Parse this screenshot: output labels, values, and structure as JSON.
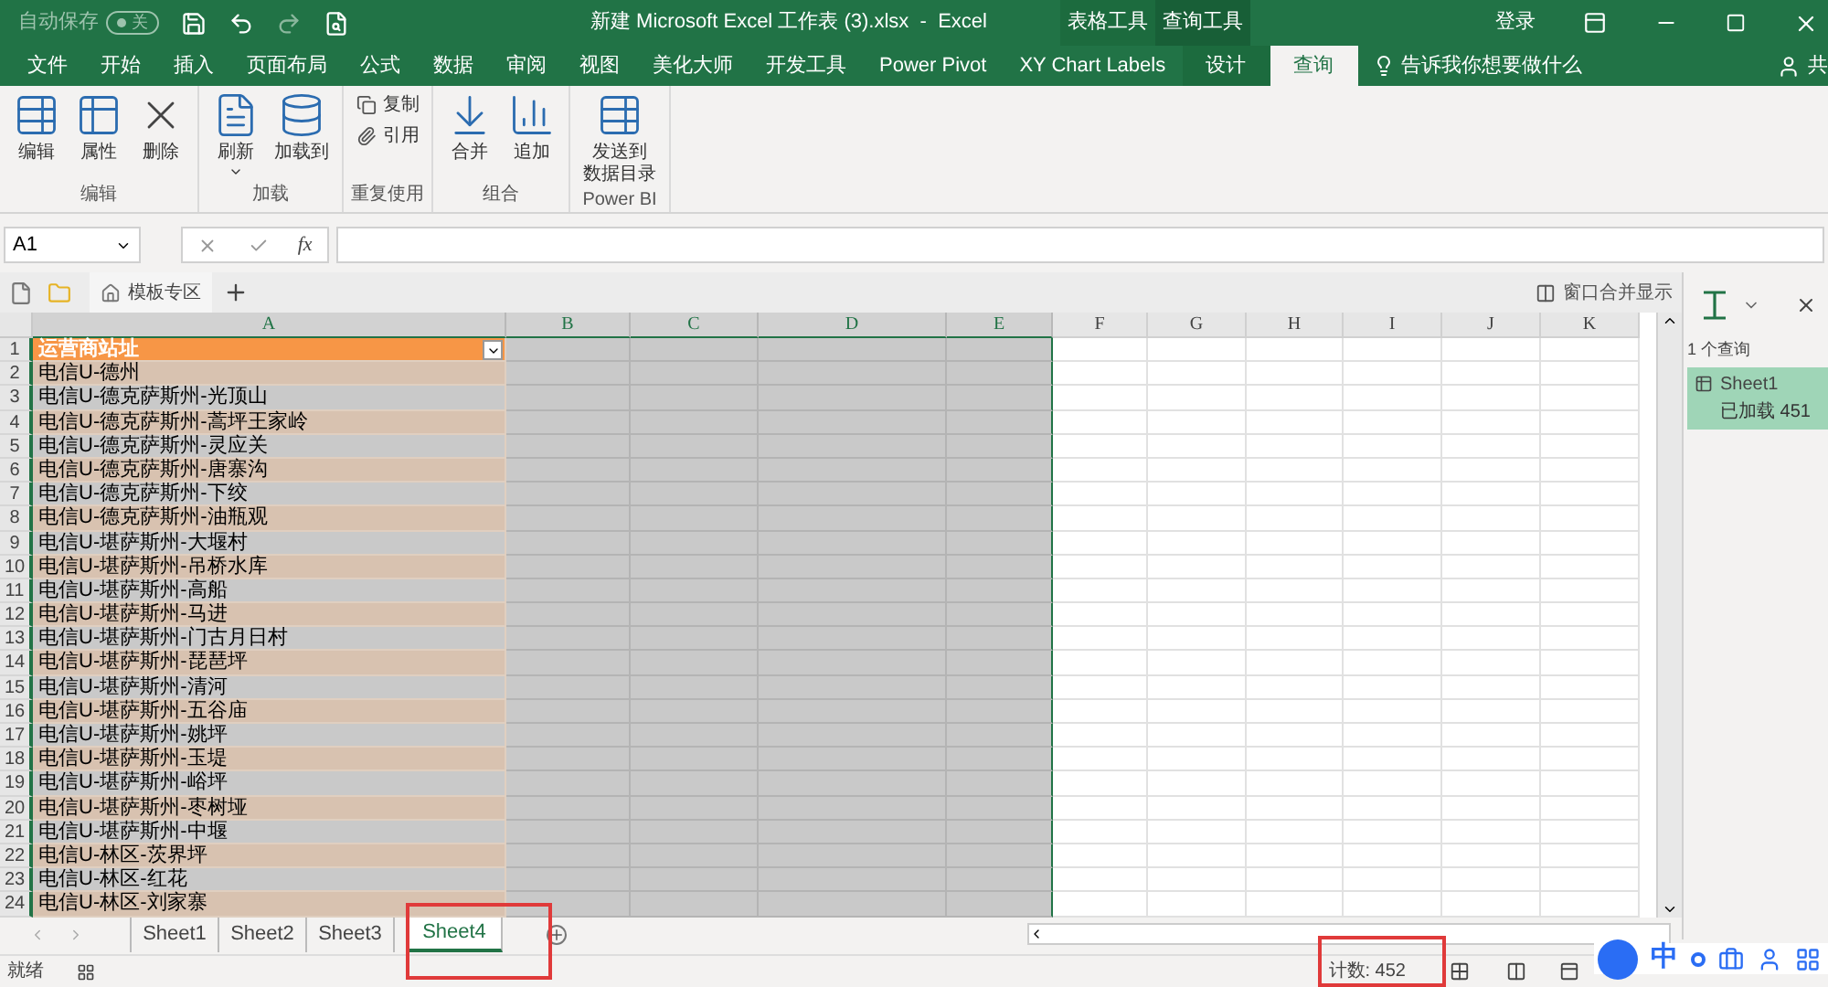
{
  "title_bar": {
    "autosave_label": "自动保存",
    "autosave_toggle": "关",
    "title": "新建 Microsoft Excel 工作表 (3).xlsx  -  Excel",
    "contextual_groups": [
      "表格工具",
      "查询工具"
    ],
    "sign_in": "登录"
  },
  "ribbon_tabs": [
    {
      "label": "文件",
      "kind": "normal",
      "selected": false
    },
    {
      "label": "开始",
      "kind": "normal",
      "selected": false
    },
    {
      "label": "插入",
      "kind": "normal",
      "selected": false
    },
    {
      "label": "页面布局",
      "kind": "normal",
      "selected": false
    },
    {
      "label": "公式",
      "kind": "normal",
      "selected": false
    },
    {
      "label": "数据",
      "kind": "normal",
      "selected": false
    },
    {
      "label": "审阅",
      "kind": "normal",
      "selected": false
    },
    {
      "label": "视图",
      "kind": "normal",
      "selected": false
    },
    {
      "label": "美化大师",
      "kind": "normal",
      "selected": false
    },
    {
      "label": "开发工具",
      "kind": "normal",
      "selected": false
    },
    {
      "label": "Power Pivot",
      "kind": "normal",
      "selected": false
    },
    {
      "label": "XY Chart Labels",
      "kind": "normal",
      "selected": false
    },
    {
      "label": "设计",
      "kind": "contextual",
      "selected": false
    },
    {
      "label": "查询",
      "kind": "contextual",
      "selected": true
    }
  ],
  "tell_me": "告诉我你想要做什么",
  "share": "共",
  "ribbon_groups": [
    {
      "label": "编辑",
      "buttons": [
        {
          "label": "编辑",
          "kind": "large"
        },
        {
          "label": "属性",
          "kind": "large"
        },
        {
          "label": "删除",
          "kind": "large"
        }
      ]
    },
    {
      "label": "加载",
      "buttons": [
        {
          "label": "刷新",
          "kind": "dropdown"
        },
        {
          "label": "加载到",
          "kind": "large"
        }
      ]
    },
    {
      "label": "重复使用",
      "buttons": [
        {
          "label": "复制",
          "kind": "small"
        },
        {
          "label": "引用",
          "kind": "small"
        }
      ]
    },
    {
      "label": "组合",
      "buttons": [
        {
          "label": "合并",
          "kind": "large"
        },
        {
          "label": "追加",
          "kind": "large"
        }
      ]
    },
    {
      "label": "Power BI",
      "buttons": [
        {
          "label_lines": [
            "发送到",
            "数据目录"
          ],
          "kind": "large"
        }
      ]
    }
  ],
  "name_box": "A1",
  "function_button": "fx",
  "doc_tabs": [
    "模板专区"
  ],
  "merge_display": "窗口合并显示",
  "columns": [
    {
      "label": "A",
      "selected": true
    },
    {
      "label": "B",
      "selected": true
    },
    {
      "label": "C",
      "selected": true
    },
    {
      "label": "D",
      "selected": true
    },
    {
      "label": "E",
      "selected": true
    },
    {
      "label": "F",
      "selected": false
    },
    {
      "label": "G",
      "selected": false
    },
    {
      "label": "H",
      "selected": false
    },
    {
      "label": "I",
      "selected": false
    },
    {
      "label": "J",
      "selected": false
    },
    {
      "label": "K",
      "selected": false
    }
  ],
  "rows": [
    {
      "number": "1",
      "value": "运营商站址",
      "kind": "header"
    },
    {
      "number": "2",
      "value": "电信U-德州",
      "kind": "data"
    },
    {
      "number": "3",
      "value": "电信U-德克萨斯州-光顶山",
      "kind": "data"
    },
    {
      "number": "4",
      "value": "电信U-德克萨斯州-蒿坪王家岭",
      "kind": "data"
    },
    {
      "number": "5",
      "value": "电信U-德克萨斯州-灵应关",
      "kind": "data"
    },
    {
      "number": "6",
      "value": "电信U-德克萨斯州-唐寨沟",
      "kind": "data"
    },
    {
      "number": "7",
      "value": "电信U-德克萨斯州-下绞",
      "kind": "data"
    },
    {
      "number": "8",
      "value": "电信U-德克萨斯州-油瓶观",
      "kind": "data"
    },
    {
      "number": "9",
      "value": "电信U-堪萨斯州-大堰村",
      "kind": "data"
    },
    {
      "number": "10",
      "value": "电信U-堪萨斯州-吊桥水库",
      "kind": "data"
    },
    {
      "number": "11",
      "value": "电信U-堪萨斯州-高船",
      "kind": "data"
    },
    {
      "number": "12",
      "value": "电信U-堪萨斯州-马进",
      "kind": "data"
    },
    {
      "number": "13",
      "value": "电信U-堪萨斯州-门古月日村",
      "kind": "data"
    },
    {
      "number": "14",
      "value": "电信U-堪萨斯州-琵琶坪",
      "kind": "data"
    },
    {
      "number": "15",
      "value": "电信U-堪萨斯州-清河",
      "kind": "data"
    },
    {
      "number": "16",
      "value": "电信U-堪萨斯州-五谷庙",
      "kind": "data"
    },
    {
      "number": "17",
      "value": "电信U-堪萨斯州-姚坪",
      "kind": "data"
    },
    {
      "number": "18",
      "value": "电信U-堪萨斯州-玉堤",
      "kind": "data"
    },
    {
      "number": "19",
      "value": "电信U-堪萨斯州-峪坪",
      "kind": "data"
    },
    {
      "number": "20",
      "value": "电信U-堪萨斯州-枣树垭",
      "kind": "data"
    },
    {
      "number": "21",
      "value": "电信U-堪萨斯州-中堰",
      "kind": "data"
    },
    {
      "number": "22",
      "value": "电信U-林区-茨界坪",
      "kind": "data"
    },
    {
      "number": "23",
      "value": "电信U-林区-红花",
      "kind": "data"
    },
    {
      "number": "24",
      "value": "电信U-林区-刘家寨",
      "kind": "data"
    }
  ],
  "sheet_tabs": [
    {
      "label": "Sheet1",
      "selected": false
    },
    {
      "label": "Sheet2",
      "selected": false
    },
    {
      "label": "Sheet3",
      "selected": false
    },
    {
      "label": "Sheet4",
      "selected": true
    }
  ],
  "query_pane": {
    "count": "1 个查询",
    "queries": [
      {
        "name": "Sheet1",
        "status": "已加载 451",
        "selected": true
      }
    ]
  },
  "status_bar": {
    "ready": "就绪",
    "count": "计数: 452"
  },
  "ime_bar": {
    "mode": "中"
  }
}
